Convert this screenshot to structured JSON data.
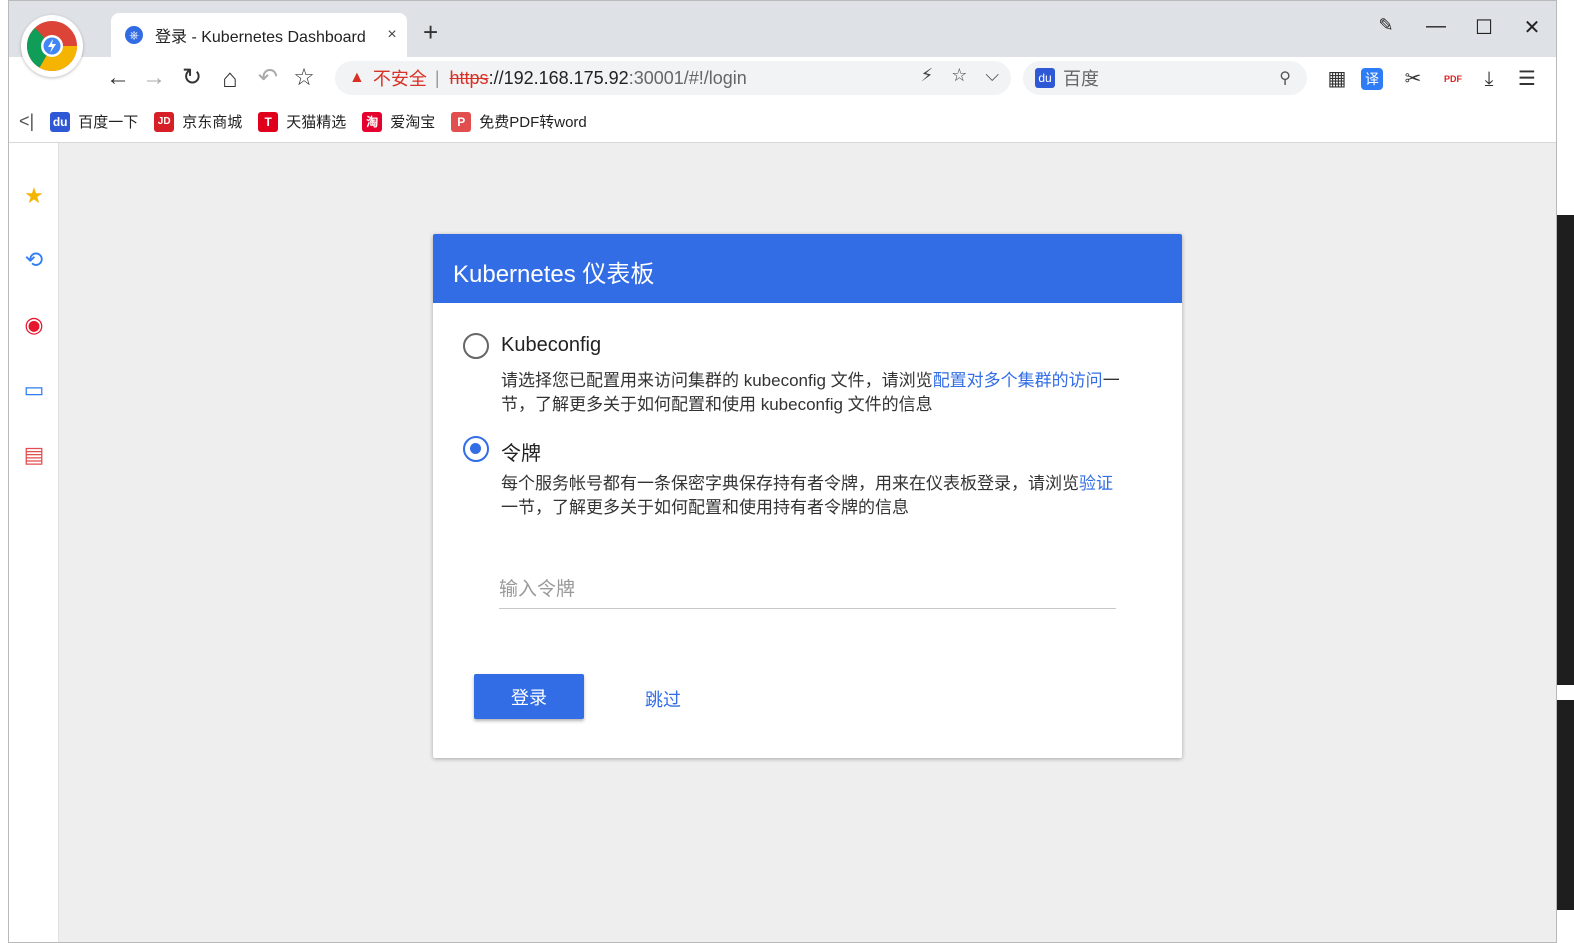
{
  "browser": {
    "tab": {
      "title": "登录 - Kubernetes Dashboard",
      "close": "×"
    },
    "new_tab": "+",
    "window_controls": {
      "note": "✎",
      "minimize": "—",
      "maximize": "☐",
      "close": "✕"
    },
    "nav": {
      "back": "←",
      "forward": "→",
      "reload": "↻",
      "home": "⌂",
      "undo": "↶",
      "favorite": "☆"
    },
    "address": {
      "warning_icon": "▲",
      "security_label": "不安全",
      "separator": "|",
      "protocol": "https",
      "host": "://192.168.175.92",
      "rest": ":30001/#!/login",
      "icons": {
        "flash": "⚡",
        "star": "☆",
        "dropdown": "⌵"
      }
    },
    "search": {
      "engine_icon": "🐾",
      "placeholder": "百度",
      "icon": "⚲"
    },
    "extensions": {
      "qr": "▦",
      "translate": "译",
      "scissors": "✂",
      "pdf": "PDF",
      "download": "⤓",
      "menu": "☰"
    },
    "bookmarks": {
      "toggle": "<|",
      "items": [
        {
          "label": "百度一下",
          "icon": "du",
          "color": "#2e58d6"
        },
        {
          "label": "京东商城",
          "icon": "JD",
          "color": "#d61f26"
        },
        {
          "label": "天猫精选",
          "icon": "T",
          "color": "#e0001b"
        },
        {
          "label": "爱淘宝",
          "icon": "淘",
          "color": "#e5002d"
        },
        {
          "label": "免费PDF转word",
          "icon": "P",
          "color": "#e24d4d"
        }
      ]
    },
    "sidebar": {
      "star": "★",
      "history": "⟲",
      "weibo": "◉",
      "card": "▭",
      "pdf": "▤"
    }
  },
  "dashboard": {
    "title": "Kubernetes 仪表板",
    "options": [
      {
        "label": "Kubeconfig",
        "selected": false,
        "desc_prefix": "请选择您已配置用来访问集群的 kubeconfig 文件，请浏览",
        "desc_link": "配置对多个集群的访问",
        "desc_suffix": "一节，了解更多关于如何配置和使用 kubeconfig 文件的信息"
      },
      {
        "label": "令牌",
        "selected": true,
        "desc_prefix": "每个服务帐号都有一条保密字典保存持有者令牌，用来在仪表板登录，请浏览",
        "desc_link": "验证",
        "desc_suffix": "一节，了解更多关于如何配置和使用持有者令牌的信息"
      }
    ],
    "token_placeholder": "输入令牌",
    "login_label": "登录",
    "skip_label": "跳过"
  },
  "colors": {
    "accent": "#326de6",
    "insecure": "#d93025"
  }
}
